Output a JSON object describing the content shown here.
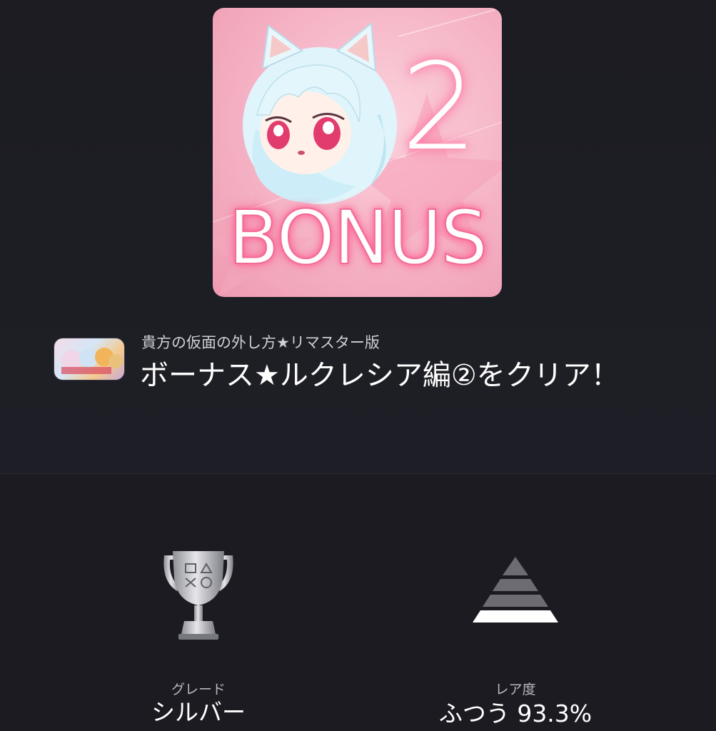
{
  "trophy_art": {
    "number": "2",
    "word": "BONUS"
  },
  "game": {
    "title": "貴方の仮面の外し方★リマスター版"
  },
  "trophy": {
    "name": "ボーナス★ルクレシア編②をクリア！"
  },
  "stats": {
    "grade": {
      "label": "グレード",
      "value": "シルバー",
      "icon": "silver-trophy-icon"
    },
    "rarity": {
      "label": "レア度",
      "value": "ふつう 93.3%",
      "icon": "rarity-pyramid-icon"
    }
  },
  "colors": {
    "background": "#1a1a20",
    "art_pink": "#f5b3c5",
    "text_secondary": "#b8b8c0"
  }
}
